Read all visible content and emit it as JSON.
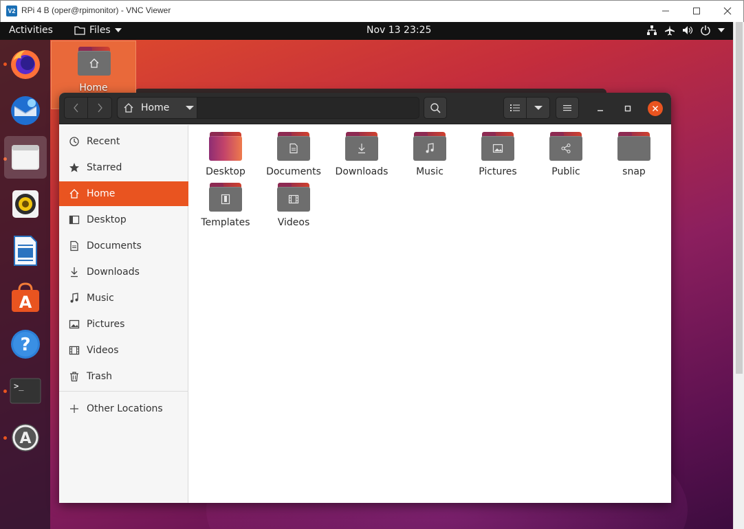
{
  "vnc": {
    "title": "RPi 4 B (oper@rpimonitor) - VNC Viewer",
    "logo_text": "V2"
  },
  "topbar": {
    "activities": "Activities",
    "app_menu": "Files",
    "clock": "Nov 13  23:25"
  },
  "dock": {
    "items": [
      {
        "name": "Firefox",
        "icon": "firefox-icon",
        "running": true
      },
      {
        "name": "Thunderbird",
        "icon": "thunderbird-icon",
        "running": false
      },
      {
        "name": "Files",
        "icon": "files-icon",
        "running": true,
        "active": true
      },
      {
        "name": "Rhythmbox",
        "icon": "rhythmbox-icon",
        "running": false
      },
      {
        "name": "LibreOffice Writer",
        "icon": "writer-icon",
        "running": false
      },
      {
        "name": "Ubuntu Software",
        "icon": "software-icon",
        "running": false
      },
      {
        "name": "Help",
        "icon": "help-icon",
        "running": false
      },
      {
        "name": "Terminal",
        "icon": "terminal-icon",
        "running": true
      },
      {
        "name": "Software Updater",
        "icon": "updater-icon",
        "running": true
      }
    ]
  },
  "desktop": {
    "home_label": "Home"
  },
  "nautilus": {
    "path_label": "Home",
    "sidebar": [
      {
        "label": "Recent",
        "icon": "recent-icon"
      },
      {
        "label": "Starred",
        "icon": "star-icon"
      },
      {
        "label": "Home",
        "icon": "home-icon",
        "selected": true
      },
      {
        "label": "Desktop",
        "icon": "desktop-icon"
      },
      {
        "label": "Documents",
        "icon": "documents-icon"
      },
      {
        "label": "Downloads",
        "icon": "downloads-icon"
      },
      {
        "label": "Music",
        "icon": "music-icon"
      },
      {
        "label": "Pictures",
        "icon": "pictures-icon"
      },
      {
        "label": "Videos",
        "icon": "videos-icon"
      },
      {
        "label": "Trash",
        "icon": "trash-icon"
      }
    ],
    "other_locations": "Other Locations",
    "files": [
      {
        "label": "Desktop",
        "icon": "desktop-folder-icon"
      },
      {
        "label": "Documents",
        "icon": "documents-folder-icon"
      },
      {
        "label": "Downloads",
        "icon": "downloads-folder-icon"
      },
      {
        "label": "Music",
        "icon": "music-folder-icon"
      },
      {
        "label": "Pictures",
        "icon": "pictures-folder-icon"
      },
      {
        "label": "Public",
        "icon": "public-folder-icon"
      },
      {
        "label": "snap",
        "icon": "folder-icon"
      },
      {
        "label": "Templates",
        "icon": "templates-folder-icon"
      },
      {
        "label": "Videos",
        "icon": "videos-folder-icon"
      }
    ]
  },
  "colors": {
    "accent": "#e95420",
    "header": "#2c2c2c",
    "topbar": "#121212"
  }
}
